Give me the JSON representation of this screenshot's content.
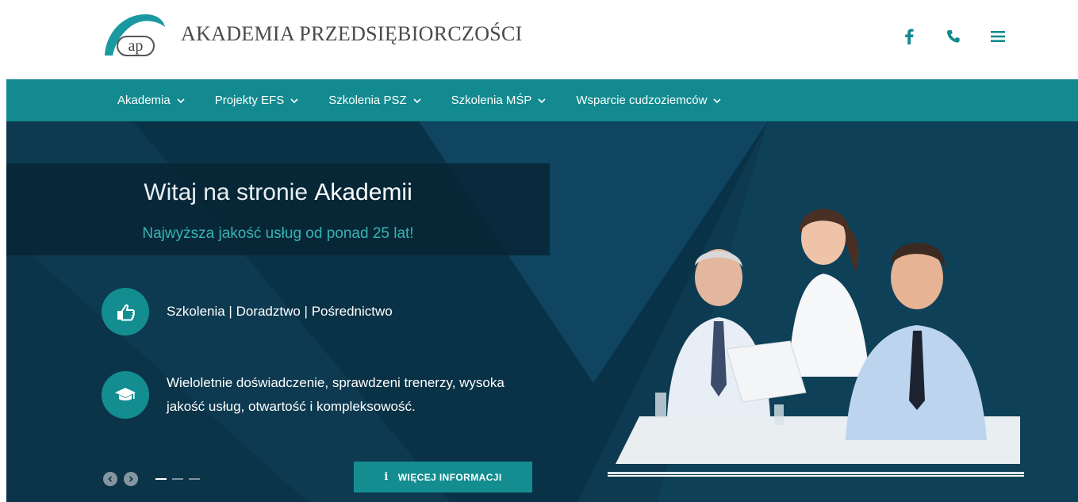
{
  "header": {
    "brand": "AKADEMIA PRZEDSIĘBIORCZOŚCI",
    "logo_letters": "ap",
    "icons": [
      "facebook-icon",
      "phone-icon",
      "menu-icon"
    ]
  },
  "nav": {
    "items": [
      {
        "label": "Akademia"
      },
      {
        "label": "Projekty EFS"
      },
      {
        "label": "Szkolenia PSZ"
      },
      {
        "label": "Szkolenia MŚP"
      },
      {
        "label": "Wsparcie cudzoziemców"
      }
    ]
  },
  "hero": {
    "title_lead": "Witaj na stronie",
    "title_strong": "Akademii",
    "subtitle": "Najwyższa jakość usług od ponad 25 lat!",
    "features": [
      {
        "icon": "hand-pointer-icon",
        "text": "Szkolenia | Doradztwo | Pośrednictwo"
      },
      {
        "icon": "graduation-cap-icon",
        "line1": "Wieloletnie doświadczenie, sprawdzeni trenerzy, wysoka",
        "line2": "jakość usług, otwartość i kompleksowość."
      }
    ],
    "more_button": "WIĘCEJ INFORMACJI",
    "slides": {
      "count": 3,
      "active": 1
    }
  },
  "colors": {
    "teal": "#128a8f",
    "hero_bg": "#0d3a50",
    "accent_text": "#36b3b3"
  }
}
